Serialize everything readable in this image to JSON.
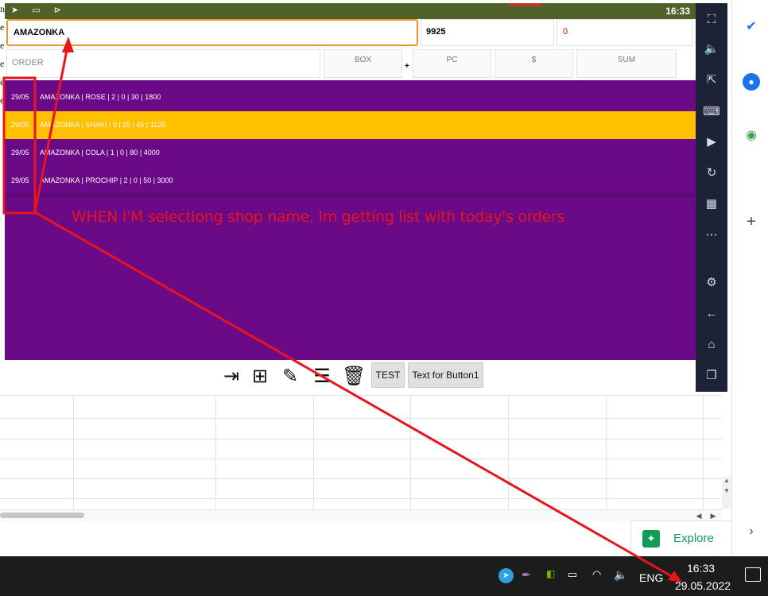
{
  "spreadsheet": {
    "left_letters": [
      "n",
      "e",
      "e",
      "e",
      "e",
      "e"
    ],
    "explore_label": "Explore"
  },
  "emulator": {
    "status_time": "16:33",
    "shop_field_value": "AMAZONKA",
    "code_field_value": "9925",
    "red_field_value": "0",
    "order_placeholder": "ORDER",
    "columns": {
      "box": "BOX",
      "plus": "+",
      "pc": "PC",
      "dollar": "$",
      "sum": "SUM"
    },
    "orders": [
      {
        "date": "29/05",
        "text": "AMAZONKA | ROSE | 2 | 0 | 30 | 1800",
        "selected": false
      },
      {
        "date": "29/05",
        "text": "AMAZONKA | SHAKI | 0 | 25 | 45 | 1125",
        "selected": true
      },
      {
        "date": "29/05",
        "text": "AMAZONKA | COLA | 1 | 0 | 80 | 4000",
        "selected": false
      },
      {
        "date": "29/05",
        "text": "AMAZONKA | PROCHIP | 2 | 0 | 50 | 3000",
        "selected": false
      }
    ],
    "toolbar": {
      "test_label": "TEST",
      "button1_label": "Text for Button1"
    },
    "colors": {
      "list_bg": "#6a0a87",
      "selected_row": "#ffc000",
      "status_bar": "#4f6228",
      "annotation": "#e8141c"
    }
  },
  "annotation": {
    "text": "WHEN I'M selectiong shop name, Im getting list with today's orders"
  },
  "taskbar": {
    "language": "ENG",
    "time": "16:33",
    "date": "29.05.2022"
  }
}
